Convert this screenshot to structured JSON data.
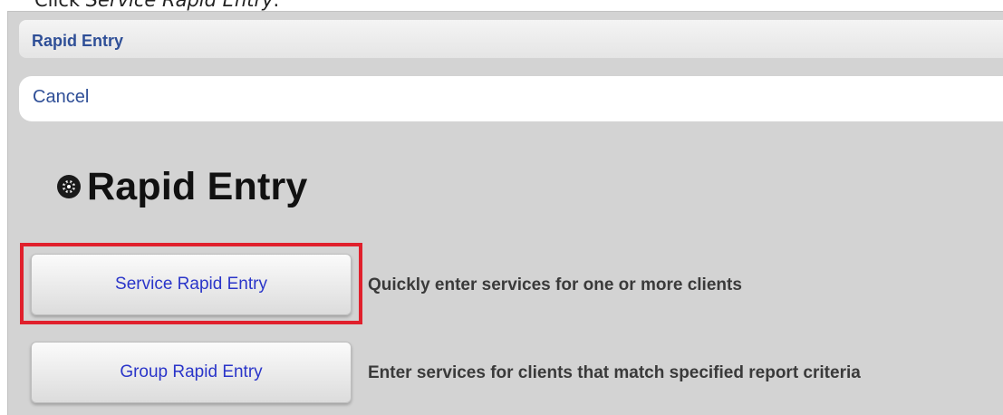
{
  "instruction": {
    "prefix": "Click ",
    "target": "Service Rapid Entry",
    "suffix": "."
  },
  "header": {
    "title": "Rapid Entry"
  },
  "nav": {
    "cancel_label": "Cancel"
  },
  "page": {
    "title": "Rapid Entry",
    "icon": "gear-icon"
  },
  "options": [
    {
      "label": "Service Rapid Entry",
      "description": "Quickly enter services for one or more clients",
      "highlighted": true
    },
    {
      "label": "Group Rapid Entry",
      "description": "Enter services for clients that match specified report criteria",
      "highlighted": false
    }
  ],
  "colors": {
    "panel_bg": "#d3d3d3",
    "link_blue": "#2f4f97",
    "button_text": "#2a35c9",
    "highlight_red": "#e0202c"
  }
}
